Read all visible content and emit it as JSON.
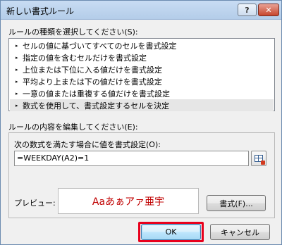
{
  "window": {
    "title": "新しい書式ルール",
    "help_label": "?",
    "close_label": "✕"
  },
  "rule_type": {
    "label": "ルールの種類を選択してください(S):",
    "items": [
      {
        "label": "セルの値に基づいてすべてのセルを書式設定",
        "selected": false
      },
      {
        "label": "指定の値を含むセルだけを書式設定",
        "selected": false
      },
      {
        "label": "上位または下位に入る値だけを書式設定",
        "selected": false
      },
      {
        "label": "平均より上または下の値だけを書式設定",
        "selected": false
      },
      {
        "label": "一意の値または重複する値だけを書式設定",
        "selected": false
      },
      {
        "label": "数式を使用して、書式設定するセルを決定",
        "selected": true
      }
    ]
  },
  "rule_description": {
    "label": "ルールの内容を編集してください(E):",
    "formula_label": "次の数式を満たす場合に値を書式設定(O):",
    "formula_value": "=WEEKDAY(A2)=1",
    "preview_label": "プレビュー:",
    "preview_text": "Aaあぁアァ亜宇",
    "preview_color": "#c00000",
    "format_button": "書式(F)..."
  },
  "footer": {
    "ok_label": "OK",
    "cancel_label": "キャンセル",
    "highlight_color": "#e8001c"
  },
  "icons": {
    "list_bullet": "▸",
    "range_picker": "range-picker-icon"
  }
}
